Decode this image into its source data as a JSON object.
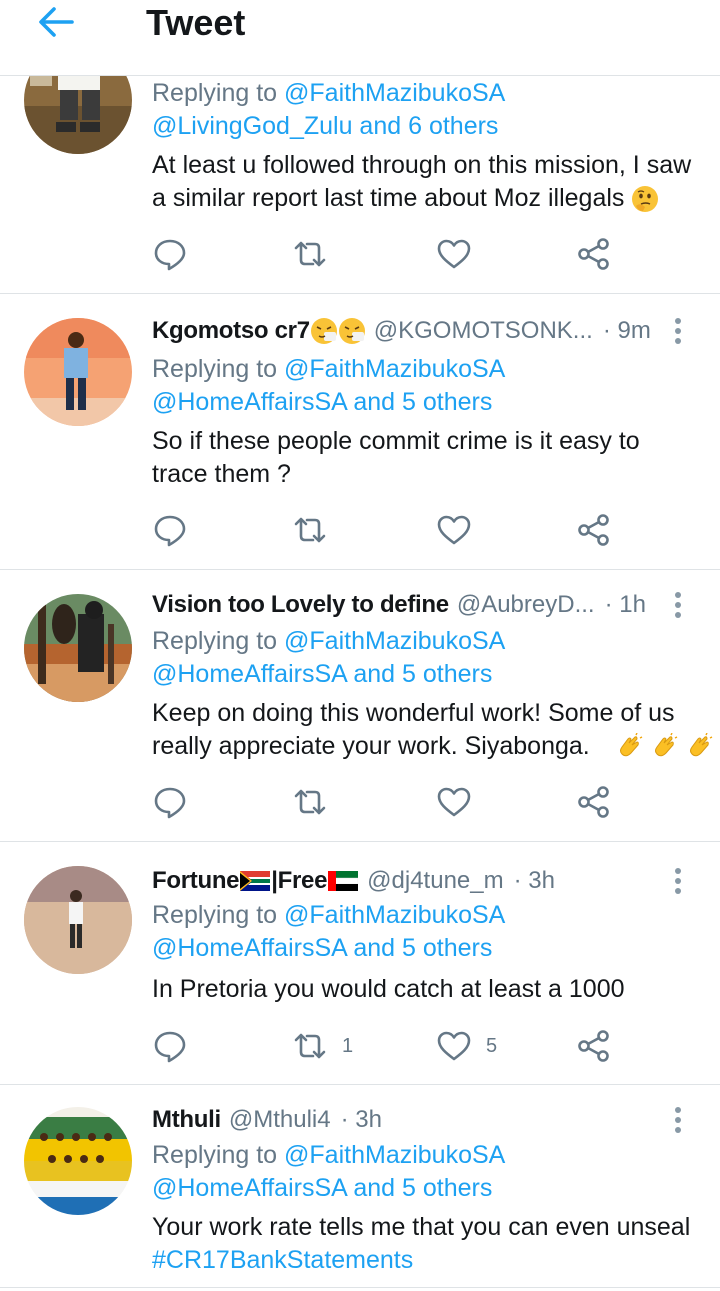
{
  "header": {
    "title": "Tweet"
  },
  "replying_to_label": "Replying to",
  "tweets": [
    {
      "name": "",
      "handle": "",
      "time": "",
      "reply_to": "@FaithMazibukoSA",
      "reply_also": "@LivingGod_Zulu and 6 others",
      "text_line1": "At least u followed through on this mission, I saw",
      "text_line2": "a similar report last time about Moz illegals",
      "retweets": "",
      "likes": ""
    },
    {
      "name": "Kgomotso cr7",
      "handle": "@KGOMOTSONK...",
      "time": "· 9m",
      "reply_to": "@FaithMazibukoSA",
      "reply_also": "@HomeAffairsSA and 5 others",
      "text_line1": "So if these people commit crime is it easy to",
      "text_line2": "trace them ?",
      "retweets": "",
      "likes": ""
    },
    {
      "name": "Vision too Lovely to define",
      "handle": "@AubreyD...",
      "time": "· 1h",
      "reply_to": "@FaithMazibukoSA",
      "reply_also": "@HomeAffairsSA and 5 others",
      "text_line1": "Keep on doing this wonderful work! Some of us",
      "text_line2": "really appreciate your work.  Siyabonga.",
      "retweets": "",
      "likes": ""
    },
    {
      "name_part1": "Fortune",
      "name_part2": "|Free",
      "handle": "@dj4tune_m",
      "time": "· 3h",
      "reply_to": "@FaithMazibukoSA",
      "reply_also": "@HomeAffairsSA and 5 others",
      "text_line1": "In Pretoria you would catch at least a 1000",
      "retweets": "1",
      "likes": "5"
    },
    {
      "name": "Mthuli",
      "handle": "@Mthuli4",
      "time": "· 3h",
      "reply_to": "@FaithMazibukoSA",
      "reply_also": "@HomeAffairsSA and 5 others",
      "text_line1": "Your work rate tells me that you can even unseal",
      "hashtag": "#CR17BankStatements"
    }
  ],
  "icons": {
    "back": "arrow-left-icon",
    "reply": "reply-icon",
    "retweet": "retweet-icon",
    "like": "heart-icon",
    "share": "share-icon",
    "more": "more-vertical-icon"
  },
  "colors": {
    "accent": "#1da1f2",
    "secondary_text": "#657786",
    "divider": "#dfe3e6"
  }
}
